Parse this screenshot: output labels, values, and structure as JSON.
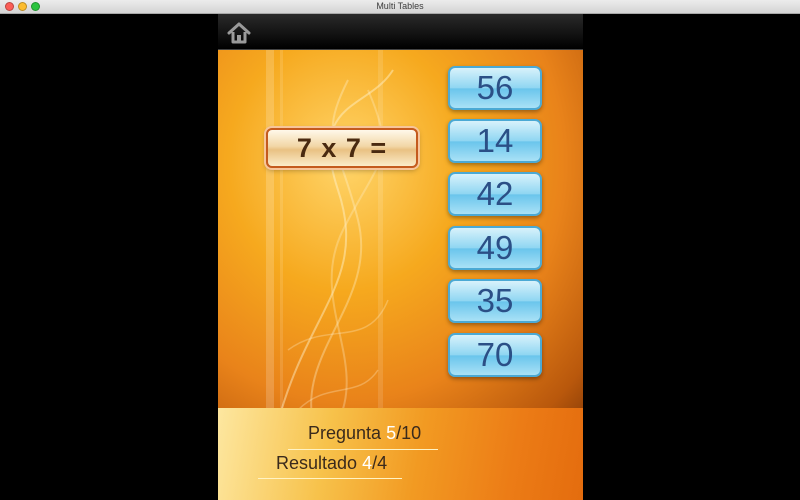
{
  "window": {
    "title": "Multi Tables"
  },
  "question": {
    "text": "7 x 7 ="
  },
  "answers": [
    "56",
    "14",
    "42",
    "49",
    "35",
    "70"
  ],
  "footer": {
    "question_label": "Pregunta",
    "question_current": "5",
    "question_total": "/10",
    "result_label": "Resultado",
    "result_current": "4",
    "result_total": "/4"
  },
  "icons": {
    "home": "home-icon"
  },
  "colors": {
    "background": "#000000",
    "answer_text": "#2b4f86",
    "highlight": "#ffffff"
  }
}
